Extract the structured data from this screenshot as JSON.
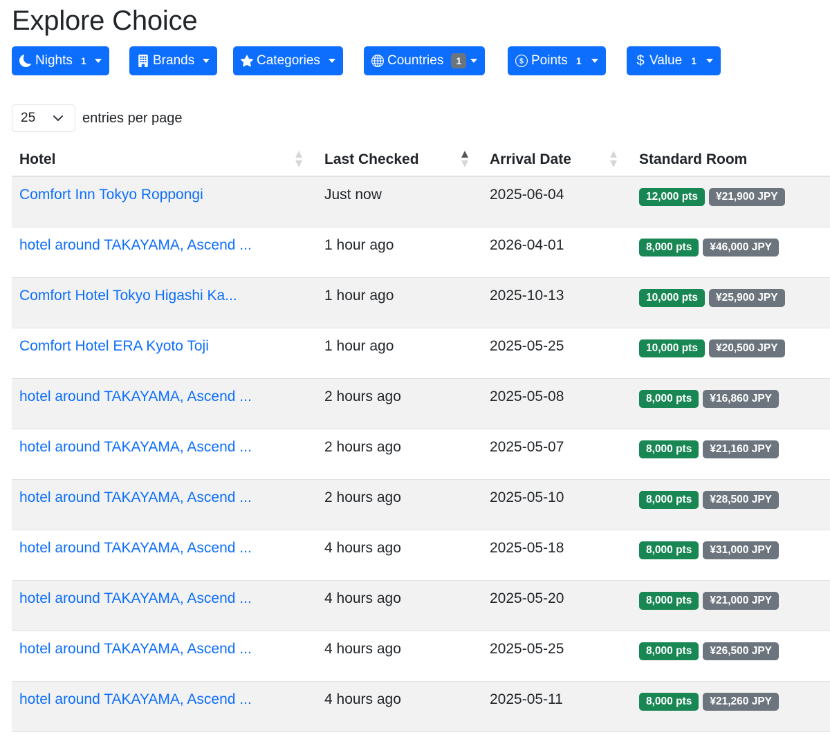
{
  "page_title": "Explore Choice",
  "filters": [
    {
      "label": "Nights",
      "count": "1",
      "icon": "moon-icon"
    },
    {
      "label": "Brands",
      "count": "",
      "icon": "building-icon"
    },
    {
      "label": "Categories",
      "count": "",
      "icon": "star-icon"
    },
    {
      "label": "Countries",
      "count": "1",
      "icon": "globe-icon"
    },
    {
      "label": "Points",
      "count": "1",
      "icon": "coins-icon"
    },
    {
      "label": "Value",
      "count": "1",
      "icon": "dollar-icon"
    }
  ],
  "entries": {
    "selected": "25",
    "label": "entries per page"
  },
  "table": {
    "headers": {
      "hotel": "Hotel",
      "last_checked": "Last Checked",
      "arrival_date": "Arrival Date",
      "standard_room": "Standard Room"
    },
    "rows": [
      {
        "hotel": "Comfort Inn Tokyo Roppongi",
        "last_checked": "Just now",
        "arrival": "2025-06-04",
        "points": "12,000 pts",
        "price": "¥21,900 JPY"
      },
      {
        "hotel": "hotel around TAKAYAMA, Ascend ...",
        "last_checked": "1 hour ago",
        "arrival": "2026-04-01",
        "points": "8,000 pts",
        "price": "¥46,000 JPY"
      },
      {
        "hotel": "Comfort Hotel Tokyo Higashi Ka...",
        "last_checked": "1 hour ago",
        "arrival": "2025-10-13",
        "points": "10,000 pts",
        "price": "¥25,900 JPY"
      },
      {
        "hotel": "Comfort Hotel ERA Kyoto Toji",
        "last_checked": "1 hour ago",
        "arrival": "2025-05-25",
        "points": "10,000 pts",
        "price": "¥20,500 JPY"
      },
      {
        "hotel": "hotel around TAKAYAMA, Ascend ...",
        "last_checked": "2 hours ago",
        "arrival": "2025-05-08",
        "points": "8,000 pts",
        "price": "¥16,860 JPY"
      },
      {
        "hotel": "hotel around TAKAYAMA, Ascend ...",
        "last_checked": "2 hours ago",
        "arrival": "2025-05-07",
        "points": "8,000 pts",
        "price": "¥21,160 JPY"
      },
      {
        "hotel": "hotel around TAKAYAMA, Ascend ...",
        "last_checked": "2 hours ago",
        "arrival": "2025-05-10",
        "points": "8,000 pts",
        "price": "¥28,500 JPY"
      },
      {
        "hotel": "hotel around TAKAYAMA, Ascend ...",
        "last_checked": "4 hours ago",
        "arrival": "2025-05-18",
        "points": "8,000 pts",
        "price": "¥31,000 JPY"
      },
      {
        "hotel": "hotel around TAKAYAMA, Ascend ...",
        "last_checked": "4 hours ago",
        "arrival": "2025-05-20",
        "points": "8,000 pts",
        "price": "¥21,000 JPY"
      },
      {
        "hotel": "hotel around TAKAYAMA, Ascend ...",
        "last_checked": "4 hours ago",
        "arrival": "2025-05-25",
        "points": "8,000 pts",
        "price": "¥26,500 JPY"
      },
      {
        "hotel": "hotel around TAKAYAMA, Ascend ...",
        "last_checked": "4 hours ago",
        "arrival": "2025-05-11",
        "points": "8,000 pts",
        "price": "¥21,260 JPY"
      }
    ]
  },
  "colors": {
    "primary": "#0d6efd",
    "success": "#198754",
    "secondary": "#6c757d",
    "stripe": "#f2f2f2"
  }
}
